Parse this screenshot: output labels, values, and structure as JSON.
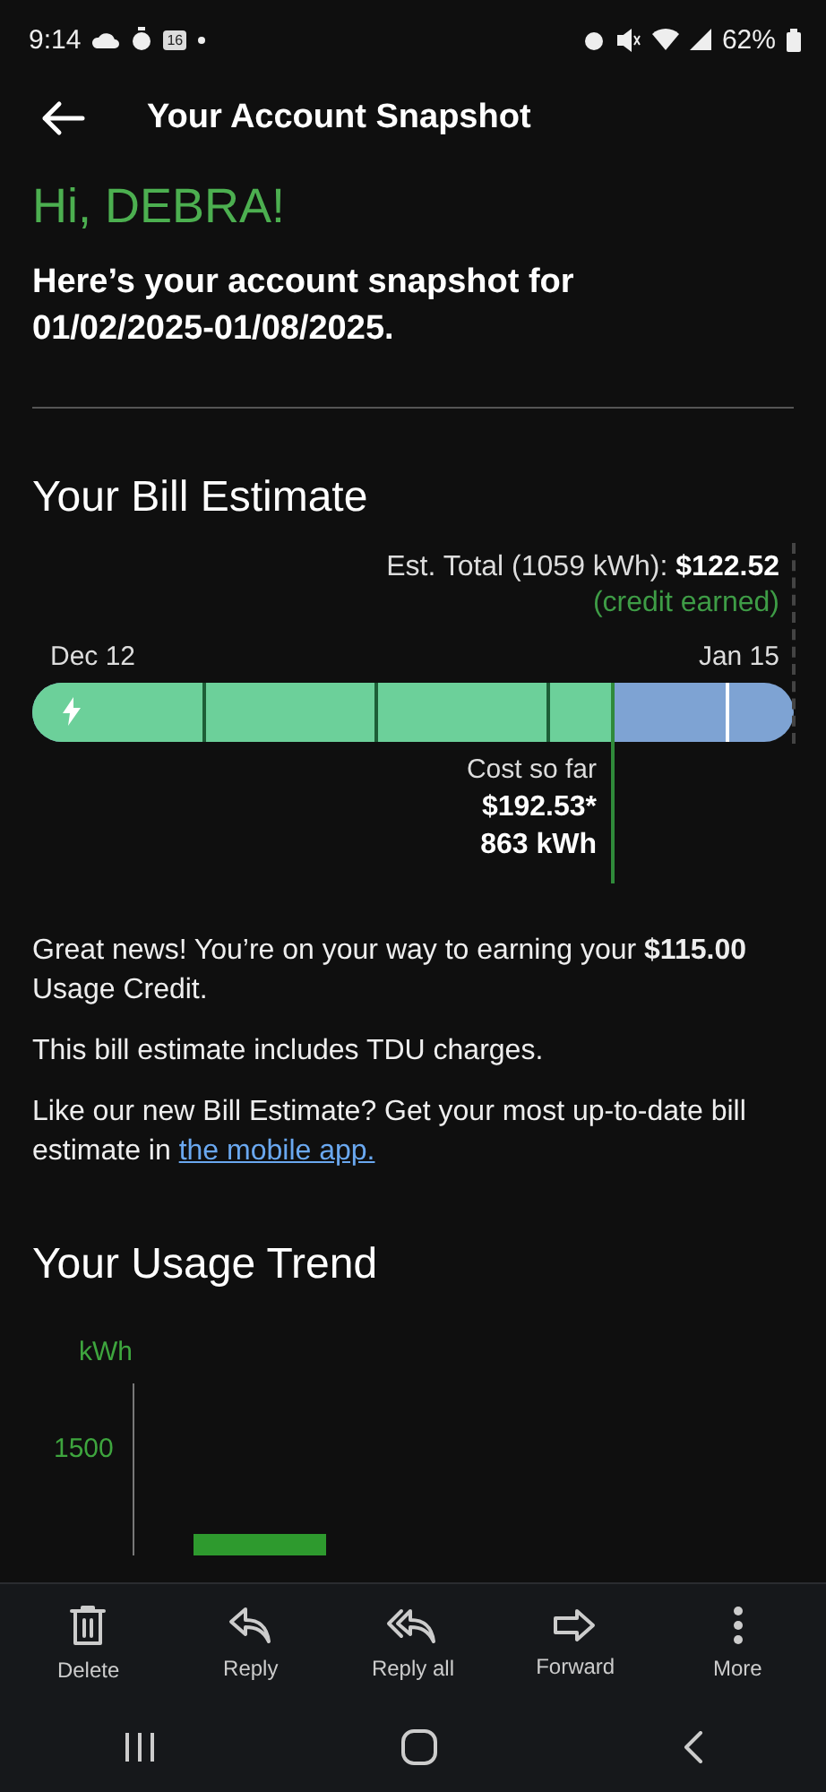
{
  "status_bar": {
    "time": "9:14",
    "calendar_day": "16",
    "battery": "62%"
  },
  "header": {
    "title": "Your Account Snapshot"
  },
  "greeting": "Hi, DEBRA!",
  "intro": "Here’s your account snapshot for 01/02/2025-01/08/2025.",
  "bill_estimate": {
    "title": "Your Bill Estimate",
    "est_total_label": "Est. Total (1059 kWh):",
    "est_total_value": "$122.52",
    "credit_note": "(credit earned)",
    "start_date": "Dec 12",
    "end_date": "Jan 15",
    "level": 0.76,
    "cost_label": "Cost so far",
    "cost_value": "$192.53*",
    "usage_value": "863 kWh"
  },
  "messages": [
    {
      "text": "Great news! You’re on your way to earning your **$115.00** Usage Credit."
    },
    {
      "text": "This bill estimate includes TDU charges."
    },
    {
      "text": "Like our new Bill Estimate? Get your most up-to-date bill estimate in",
      "link": "the mobile app."
    }
  ],
  "usage_trend": {
    "title": "Your Usage Trend",
    "unit_label": "kWh",
    "tick_label": "1500"
  },
  "toolbar": [
    {
      "kind": "delete",
      "label": "Delete"
    },
    {
      "kind": "reply",
      "label": "Reply"
    },
    {
      "kind": "reply_all",
      "label": "Reply all"
    },
    {
      "kind": "forward",
      "label": "Forward"
    },
    {
      "kind": "more",
      "label": "More"
    }
  ]
}
